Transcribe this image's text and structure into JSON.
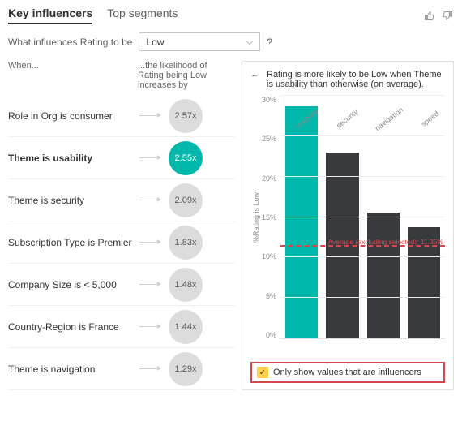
{
  "tabs": {
    "key": "Key influencers",
    "top": "Top segments"
  },
  "filter": {
    "prefix": "What influences Rating to be",
    "selected": "Low",
    "help": "?"
  },
  "columns": {
    "when": "When...",
    "likelihood": "...the likelihood of Rating being Low increases by"
  },
  "influencers": [
    {
      "label": "Role in Org is consumer",
      "value": "2.57x"
    },
    {
      "label": "Theme is usability",
      "value": "2.55x"
    },
    {
      "label": "Theme is security",
      "value": "2.09x"
    },
    {
      "label": "Subscription Type is Premier",
      "value": "1.83x"
    },
    {
      "label": "Company Size is < 5,000",
      "value": "1.48x"
    },
    {
      "label": "Country-Region is France",
      "value": "1.44x"
    },
    {
      "label": "Theme is navigation",
      "value": "1.29x"
    }
  ],
  "selected_index": 1,
  "right": {
    "title": "Rating is more likely to be Low when Theme is usability than otherwise (on average).",
    "y_label": "%Rating is Low",
    "avg_label": "Average (excluding selected): 11.35%",
    "checkbox_label": "Only show values that are influencers",
    "checkbox_checked": "✓"
  },
  "chart_data": {
    "type": "bar",
    "categories": [
      "usability",
      "security",
      "navigation",
      "speed"
    ],
    "values": [
      28.7,
      23.0,
      15.6,
      13.7
    ],
    "highlight_index": 0,
    "ylim": [
      0,
      30
    ],
    "y_ticks": [
      "30%",
      "25%",
      "20%",
      "15%",
      "10%",
      "5%",
      "0%"
    ],
    "avg": 11.35,
    "ylabel": "%Rating is Low",
    "xlabel": ""
  }
}
